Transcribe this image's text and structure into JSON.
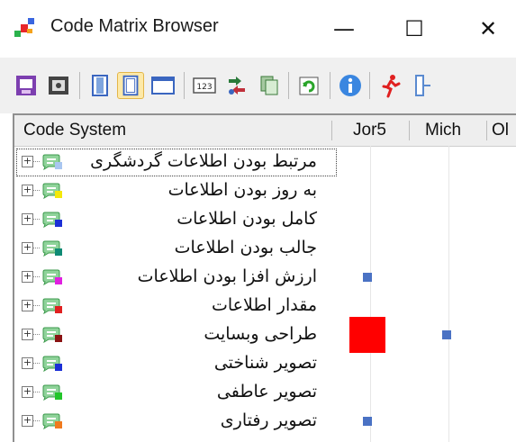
{
  "window": {
    "title": "Code Matrix Browser",
    "minimize_glyph": "—",
    "maximize_glyph": "☐",
    "close_glyph": "✕"
  },
  "toolbar": {
    "buttons": [
      {
        "name": "export-icon",
        "active": false
      },
      {
        "name": "settings-icon",
        "active": false
      },
      {
        "name": "column-view-icon",
        "active": false
      },
      {
        "name": "row-view-icon",
        "active": true
      },
      {
        "name": "window-view-icon",
        "active": false
      },
      {
        "name": "numbers-icon",
        "active": false
      },
      {
        "name": "transpose-icon",
        "active": false
      },
      {
        "name": "copy-icon",
        "active": false
      },
      {
        "name": "refresh-icon",
        "active": false
      },
      {
        "name": "info-icon",
        "active": false
      },
      {
        "name": "run-icon",
        "active": false
      },
      {
        "name": "exit-icon",
        "active": false
      }
    ]
  },
  "grid": {
    "columns": [
      "Code System",
      "Jor5",
      "Mich",
      "Ol"
    ],
    "rows": [
      {
        "label": "مرتبط بودن اطلاعات گردشگری",
        "color": "#a9c6f0",
        "selected": true,
        "jor5": 0,
        "mich": 0
      },
      {
        "label": "به روز بودن اطلاعات",
        "color": "#f4e80a",
        "selected": false,
        "jor5": 0,
        "mich": 0
      },
      {
        "label": "کامل بودن اطلاعات",
        "color": "#1b2fd6",
        "selected": false,
        "jor5": 0,
        "mich": 0
      },
      {
        "label": "جالب بودن اطلاعات",
        "color": "#0e8a74",
        "selected": false,
        "jor5": 0,
        "mich": 0
      },
      {
        "label": "ارزش افزا بودن اطلاعات",
        "color": "#e020e0",
        "selected": false,
        "jor5": 1,
        "mich": 0
      },
      {
        "label": "مقدار اطلاعات",
        "color": "#e02020",
        "selected": false,
        "jor5": 0,
        "mich": 0
      },
      {
        "label": "طراحی وبسایت",
        "color": "#8a1212",
        "selected": false,
        "jor5": 3,
        "mich": 1
      },
      {
        "label": "تصویر شناختی",
        "color": "#1b2fd6",
        "selected": false,
        "jor5": 0,
        "mich": 0
      },
      {
        "label": "تصویر عاطفی",
        "color": "#22c52a",
        "selected": false,
        "jor5": 0,
        "mich": 0
      },
      {
        "label": "تصویر رفتاری",
        "color": "#f07a1e",
        "selected": false,
        "jor5": 1,
        "mich": 0
      }
    ]
  },
  "colors": {
    "mark_small": "#4a72c4",
    "mark_large": "#ff0000"
  }
}
